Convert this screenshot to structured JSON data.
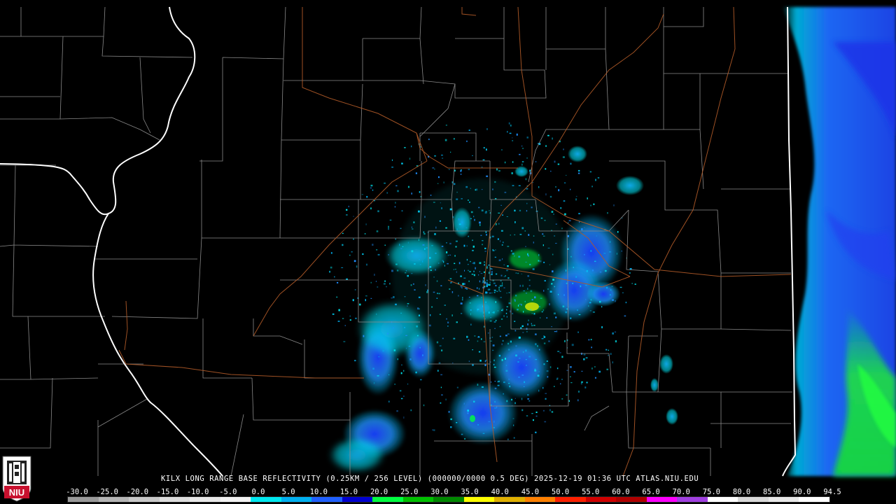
{
  "caption": "KILX LONG RANGE BASE REFLECTIVITY (0.25KM / 256 LEVEL) (000000/0000 0.5 DEG) 2025-12-19 01:36 UTC  ATLAS.NIU.EDU",
  "scale": {
    "labels": [
      "-30.0",
      "-25.0",
      "-20.0",
      "-15.0",
      "-10.0",
      "-5.0",
      "0.0",
      "5.0",
      "10.0",
      "15.0",
      "20.0",
      "25.0",
      "30.0",
      "35.0",
      "40.0",
      "45.0",
      "50.0",
      "55.0",
      "60.0",
      "65.0",
      "70.0",
      "75.0",
      "80.0",
      "85.0",
      "90.0",
      "94.5"
    ],
    "colors": [
      "#9a9a9a",
      "#b5b5b5",
      "#c8c8c8",
      "#dcdcdc",
      "#e8e8e8",
      "#f2f2f2",
      "#00e8f0",
      "#00b0f0",
      "#2060ff",
      "#0000d0",
      "#00ff40",
      "#00c000",
      "#008800",
      "#ffff00",
      "#e0b000",
      "#ff8000",
      "#ff2000",
      "#d00000",
      "#b00000",
      "#ff00ff",
      "#a040e0",
      "#ffffff",
      "#d8d8d8",
      "#e8e8e8",
      "#ffffff"
    ]
  },
  "logo": {
    "text": "NIU",
    "primary_color": "#c8102e"
  },
  "colors": {
    "river": "#ffffff",
    "county": "#8a8a8a",
    "road": "#b05a28"
  }
}
